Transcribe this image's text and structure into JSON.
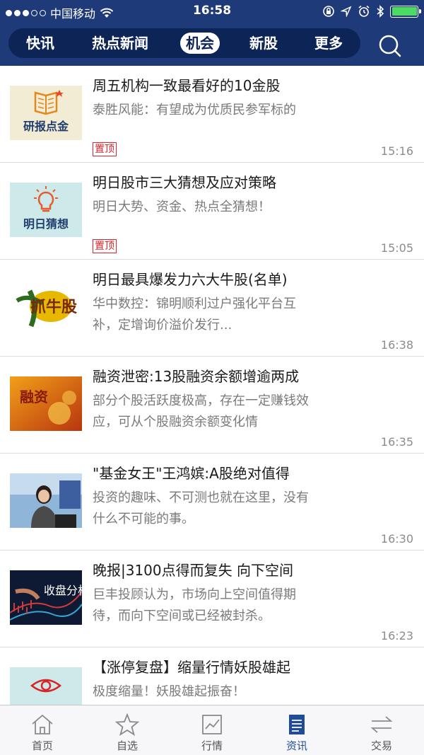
{
  "status_bar": {
    "carrier": "中国移动",
    "time": "16:58"
  },
  "nav": {
    "tabs": [
      {
        "label": "快讯",
        "active": false
      },
      {
        "label": "热点新闻",
        "active": false
      },
      {
        "label": "机会",
        "active": true
      },
      {
        "label": "新股",
        "active": false
      },
      {
        "label": "更多",
        "active": false
      }
    ],
    "search_icon": "search-icon"
  },
  "news": [
    {
      "title": "周五机构一致最看好的10金股",
      "desc": "泰胜风能：有望成为优质民参军标的",
      "pinned": true,
      "pin_label": "置顶",
      "time": "15:16",
      "thumb_text": "研报点金",
      "thumb_icon": "book-icon"
    },
    {
      "title": "明日股市三大猜想及应对策略",
      "desc": "明日大势、资金、热点全猜想！",
      "pinned": true,
      "pin_label": "置顶",
      "time": "15:05",
      "thumb_text": "明日猜想",
      "thumb_icon": "lightbulb-icon"
    },
    {
      "title": "明日最具爆发力六大牛股(名单)",
      "desc": "华中数控：锦明顺利过户强化平台互补，定增询价溢价发行...",
      "pinned": false,
      "time": "16:38",
      "thumb_text": "抓牛股",
      "thumb_icon": "bull-icon"
    },
    {
      "title": "融资泄密:13股融资余额增逾两成",
      "desc": "部分个股活跃度极高，存在一定赚钱效应，可从个股融资余额变化情",
      "pinned": false,
      "time": "16:35",
      "thumb_text": "融资",
      "thumb_icon": "money-icon"
    },
    {
      "title": "\"基金女王\"王鸿嫔:A股绝对值得",
      "desc": "投资的趣味、不可测也就在这里，没有什么不可能的事。",
      "pinned": false,
      "time": "16:30",
      "thumb_text": "",
      "thumb_icon": "person-photo"
    },
    {
      "title": "晚报|3100点得而复失 向下空间",
      "desc": "巨丰投顾认为，市场向上空间值得期待，而向下空间或已经被封杀。",
      "pinned": false,
      "time": "16:23",
      "thumb_text": "收盘分析",
      "thumb_icon": "chart-photo"
    },
    {
      "title": "【涨停复盘】缩量行情妖股雄起",
      "desc": "极度缩量！妖股雄起振奋！",
      "pinned": false,
      "time": "",
      "thumb_text": "",
      "thumb_icon": "eye-icon"
    }
  ],
  "bottom_bar": [
    {
      "label": "首页",
      "icon": "home-icon",
      "active": false
    },
    {
      "label": "自选",
      "icon": "star-icon",
      "active": false
    },
    {
      "label": "行情",
      "icon": "chart-icon",
      "active": false
    },
    {
      "label": "资讯",
      "icon": "news-icon",
      "active": true
    },
    {
      "label": "交易",
      "icon": "exchange-icon",
      "active": false
    }
  ],
  "colors": {
    "header_bg": "#1e3a78",
    "tab_pill_bg": "#0d2456",
    "pin_red": "#d9252a",
    "active_blue": "#1e4b9a"
  }
}
